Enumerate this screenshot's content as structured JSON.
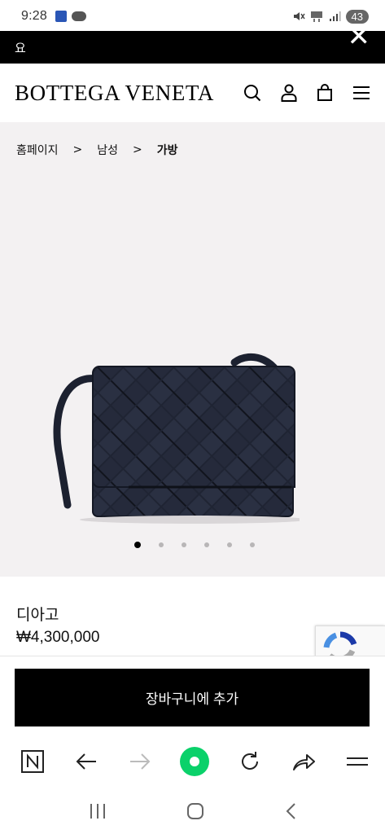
{
  "status_bar": {
    "time": "9:28",
    "battery": "43"
  },
  "promo": {
    "text": "요"
  },
  "header": {
    "logo": "BOTTEGA VENETA"
  },
  "breadcrumb": {
    "items": [
      "홈페이지",
      "남성",
      "가방"
    ],
    "separator": ">"
  },
  "carousel": {
    "slide_count": 6,
    "active_index": 0
  },
  "product": {
    "name": "디아고",
    "price": "₩4,300,000"
  },
  "cart": {
    "add_label": "장바구니에 추가"
  },
  "colors": {
    "promo_bg": "#000000",
    "product_bg": "#f3f1f2",
    "button_bg": "#000000",
    "browser_accent": "#0ad16a"
  }
}
